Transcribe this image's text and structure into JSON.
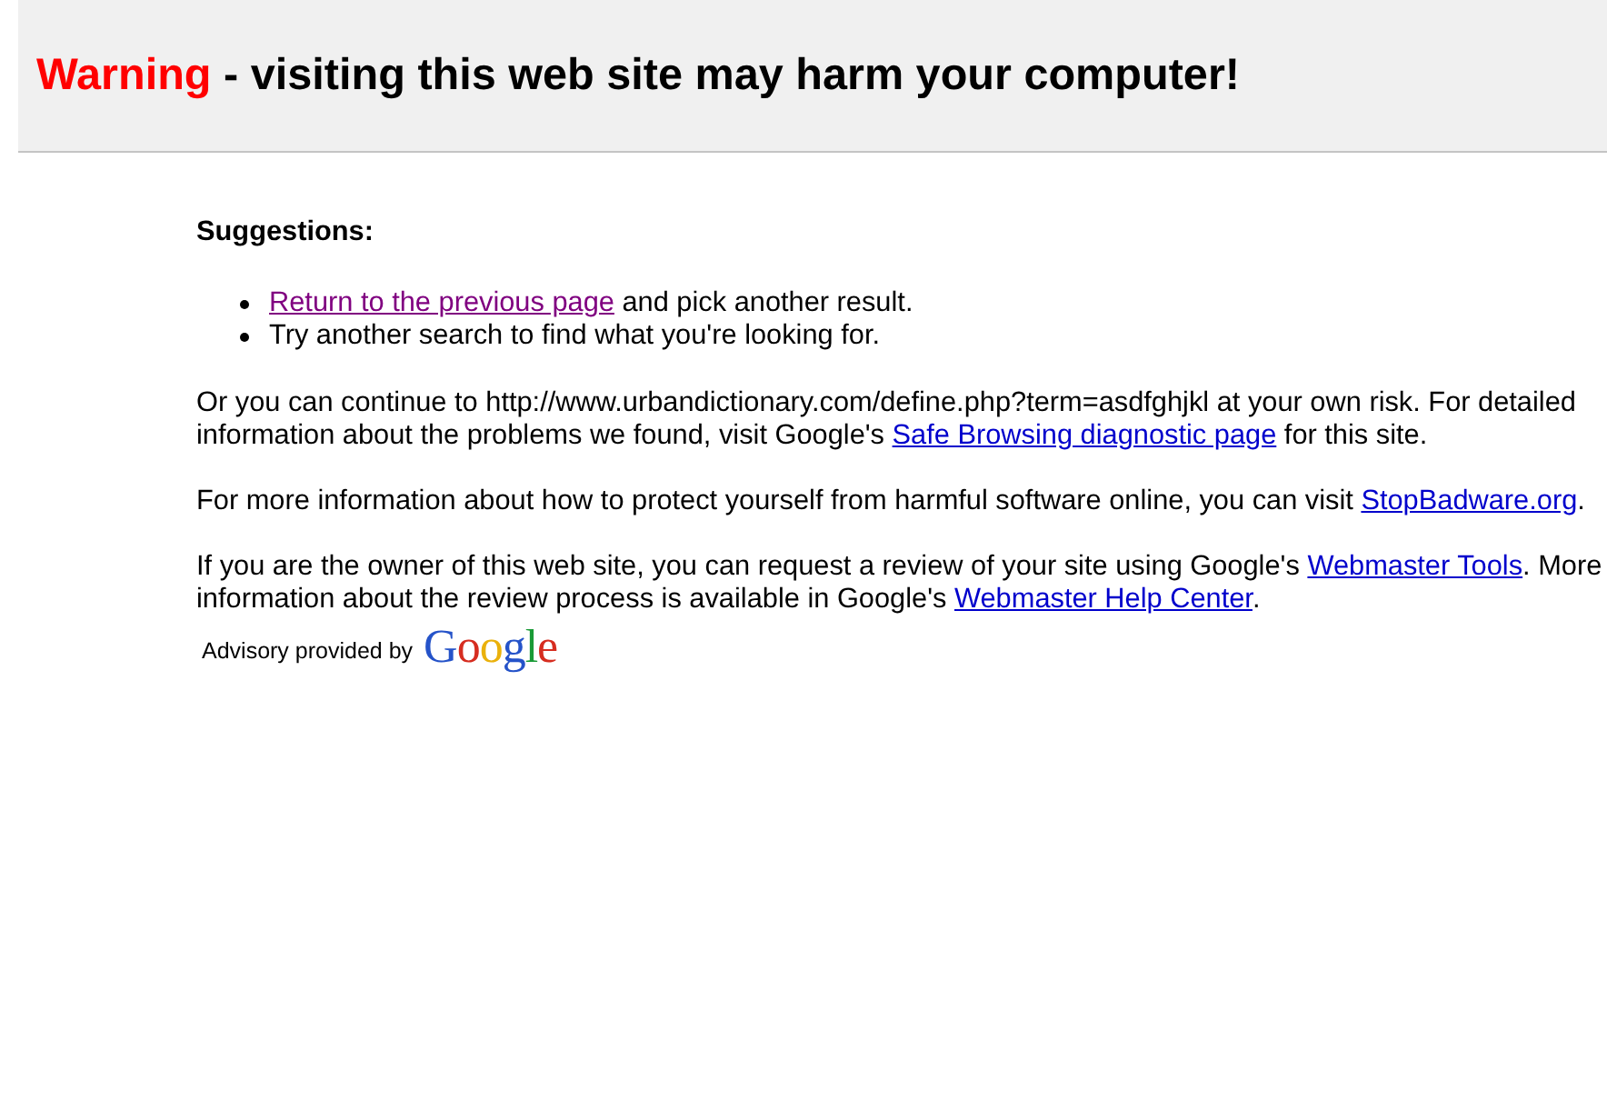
{
  "header": {
    "title": {
      "alert": "Warning",
      "text": "- visiting this web site may harm your computer!"
    }
  },
  "suggestions": {
    "heading": "Suggestions:",
    "items": [
      [
        {
          "kind": "link",
          "text": "Return to the previous page",
          "visited": true
        },
        {
          "kind": "text",
          "text": " and pick another result."
        }
      ],
      [
        {
          "kind": "text",
          "text": "Try another search to find what you're looking for."
        }
      ]
    ]
  },
  "paragraphs": [
    [
      {
        "kind": "text",
        "text": "Or you can continue to http://www.urbandictionary.com/define.php?term=asdfghjkl at your own risk. For detailed information about the problems we found, visit Google's "
      },
      {
        "kind": "link",
        "text": "Safe Browsing diagnostic page",
        "visited": false
      },
      {
        "kind": "text",
        "text": " for this site."
      }
    ],
    [
      {
        "kind": "text",
        "text": "For more information about how to protect yourself from harmful software online, you can visit "
      },
      {
        "kind": "link",
        "text": "StopBadware.org",
        "visited": false
      },
      {
        "kind": "text",
        "text": "."
      }
    ],
    [
      {
        "kind": "text",
        "text": "If you are the owner of this web site, you can request a review of your site using Google's "
      },
      {
        "kind": "link",
        "text": "Webmaster Tools",
        "visited": false
      },
      {
        "kind": "text",
        "text": ". More information about the review process is available in Google's "
      },
      {
        "kind": "link",
        "text": "Webmaster Help Center",
        "visited": false
      },
      {
        "kind": "text",
        "text": "."
      }
    ]
  ],
  "advisory": {
    "label": "Advisory provided by",
    "logo": "Google"
  }
}
